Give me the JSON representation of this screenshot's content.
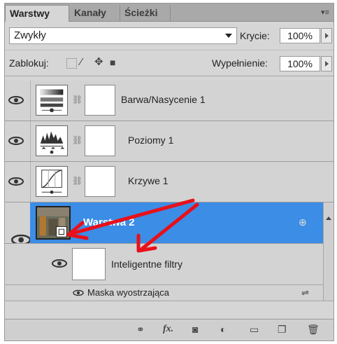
{
  "tabs": [
    {
      "label": "Warstwy"
    },
    {
      "label": "Kanały"
    },
    {
      "label": "Ścieżki"
    }
  ],
  "blend_mode": "Zwykły",
  "opacity": {
    "label": "Krycie:",
    "value": "100%"
  },
  "lock": {
    "label": "Zablokuj:"
  },
  "fill": {
    "label": "Wypełnienie:",
    "value": "100%"
  },
  "layers": [
    {
      "name": "Barwa/Nasycenie 1"
    },
    {
      "name": "Poziomy 1"
    },
    {
      "name": "Krzywe 1"
    },
    {
      "name": "Warstwa 2"
    }
  ],
  "smart_filters": {
    "label": "Inteligentne filtry"
  },
  "filter_item": {
    "label": "Maska wyostrzająca"
  },
  "footer_fx": "fx.",
  "annotation_color": "#e8101a"
}
